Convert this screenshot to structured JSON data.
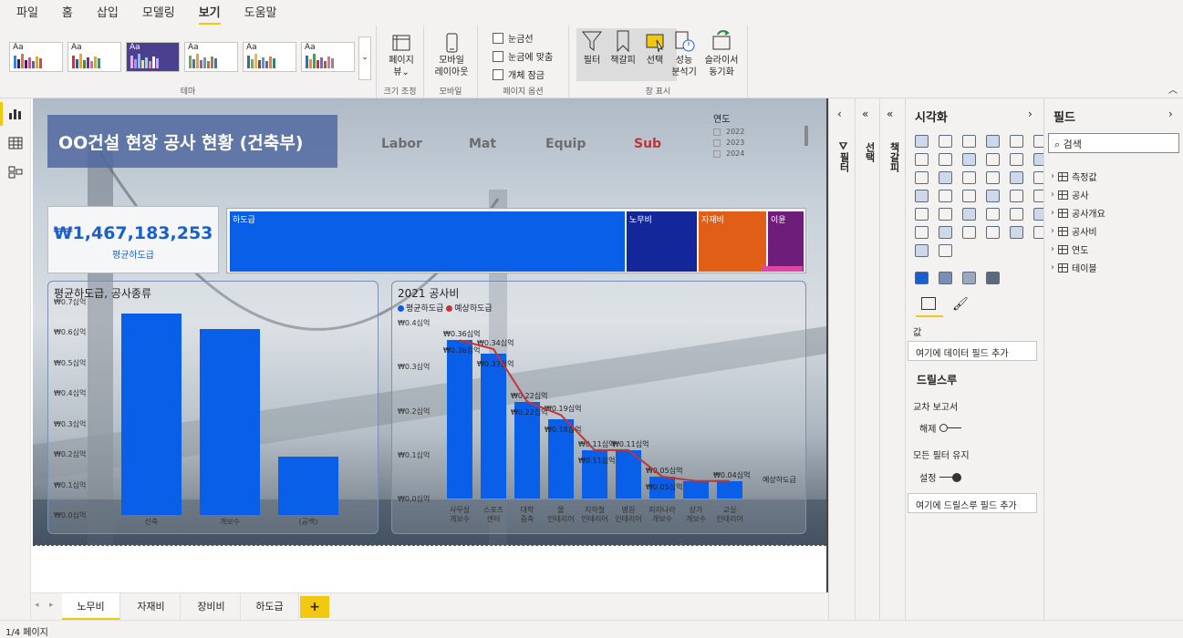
{
  "menu": {
    "tabs": [
      "파일",
      "홈",
      "삽입",
      "모델링",
      "보기",
      "도움말"
    ],
    "active": 4
  },
  "ribbon": {
    "themes_label": "테마",
    "size_group": {
      "button": "페이지\n뷰⌄",
      "label": "크기 조정"
    },
    "mobile_group": {
      "button": "모바일\n레이아웃",
      "label": "모바일"
    },
    "page_options": {
      "label": "페이지 옵션",
      "items": [
        "눈금선",
        "눈금에 맞춤",
        "개체 잠금"
      ]
    },
    "show_panes": {
      "label": "창 표시",
      "buttons": [
        "필터",
        "책갈피",
        "선택",
        "성능\n분석기",
        "슬라이서\n동기화"
      ]
    }
  },
  "report": {
    "title": "OO건설 현장 공사 현황 (건축부)",
    "nav": [
      {
        "label": "Labor",
        "color": "#6d6d6d"
      },
      {
        "label": "Mat",
        "color": "#6d6d6d"
      },
      {
        "label": "Equip",
        "color": "#6d6d6d"
      },
      {
        "label": "Sub",
        "color": "#c0343a"
      }
    ],
    "year_slicer": {
      "title": "연도",
      "years": [
        "2022",
        "2023",
        "2024"
      ]
    },
    "kpi": {
      "value": "₩1,467,183,253",
      "label": "평균하도급"
    },
    "treemap": [
      {
        "label": "하도급",
        "color": "#0a5fe8",
        "share": 0.69
      },
      {
        "label": "노무비",
        "color": "#13279b",
        "share": 0.125
      },
      {
        "label": "자재비",
        "color": "#e05e16",
        "share": 0.12
      },
      {
        "label": "이윤",
        "color": "#6f1d7a",
        "share": 0.065
      }
    ]
  },
  "chart_data": [
    {
      "type": "bar",
      "title": "평균하도급, 공사종류",
      "categories": [
        "신축",
        "개보수",
        "(공백)"
      ],
      "values": [
        0.66,
        0.61,
        0.19
      ],
      "ylim": [
        0,
        0.7
      ],
      "yticks": [
        "₩0.0십억",
        "₩0.1십억",
        "₩0.2십억",
        "₩0.3십억",
        "₩0.4십억",
        "₩0.5십억",
        "₩0.6십억",
        "₩0.7십억"
      ],
      "color": "#0a5fe8"
    },
    {
      "type": "bar",
      "title": "2021 공사비",
      "legend": [
        {
          "name": "평균하도급",
          "color": "#0a5fe8"
        },
        {
          "name": "예상하도급",
          "color": "#c0343a"
        }
      ],
      "categories": [
        "사무실\n개보수",
        "스포츠\n센터",
        "대학\n증축",
        "몰\n인테리어",
        "지하철\n인테리어",
        "병원\n인테리어",
        "피자나라\n개보수",
        "상가\n개보수",
        "교실\n인테리어"
      ],
      "series": [
        {
          "name": "평균하도급",
          "values": [
            0.36,
            0.33,
            0.22,
            0.18,
            0.11,
            0.11,
            0.05,
            0.04,
            0.04
          ],
          "labels": [
            "₩0.36십억",
            "₩0.33십억",
            "₩0.22십억",
            "₩0.18십억",
            "₩0.11십억",
            "",
            "₩0.05십억",
            "",
            ""
          ]
        },
        {
          "name": "예상하도급",
          "values": [
            0.36,
            0.34,
            0.22,
            0.19,
            0.11,
            0.11,
            0.05,
            0.04,
            0.04
          ],
          "labels": [
            "₩0.36십억",
            "₩0.34십억",
            "₩0.22십억",
            "₩0.19십억",
            "₩0.11십억",
            "₩0.11십억",
            "₩0.05십억",
            "",
            "₩0.04십억"
          ]
        }
      ],
      "ylim": [
        0,
        0.4
      ],
      "yticks": [
        "₩0.0십억",
        "₩0.1십억",
        "₩0.2십억",
        "₩0.3십억",
        "₩0.4십억"
      ],
      "extra_label": "예상하도급"
    }
  ],
  "panes": {
    "filter": "필터",
    "selection": "선택",
    "bookmark": "책갈피",
    "viz": {
      "title": "시각화",
      "values_label": "값",
      "values_well": "여기에 데이터 필드 추가",
      "drill": "드릴스루",
      "cross_report": "교차 보고서",
      "cross_state": "해제",
      "keep_filters": "모든 필터 유지",
      "keep_state": "설정",
      "drill_well": "여기에 드릴스루 필드 추가"
    },
    "fields": {
      "title": "필드",
      "search_placeholder": "검색",
      "items": [
        "측정값",
        "공사",
        "공사개요",
        "공사비",
        "연도",
        "테이블"
      ]
    }
  },
  "pages": {
    "tabs": [
      "노무비",
      "자재비",
      "장비비",
      "하도급"
    ],
    "active": 0,
    "add": "+",
    "status": "1/4 페이지"
  }
}
